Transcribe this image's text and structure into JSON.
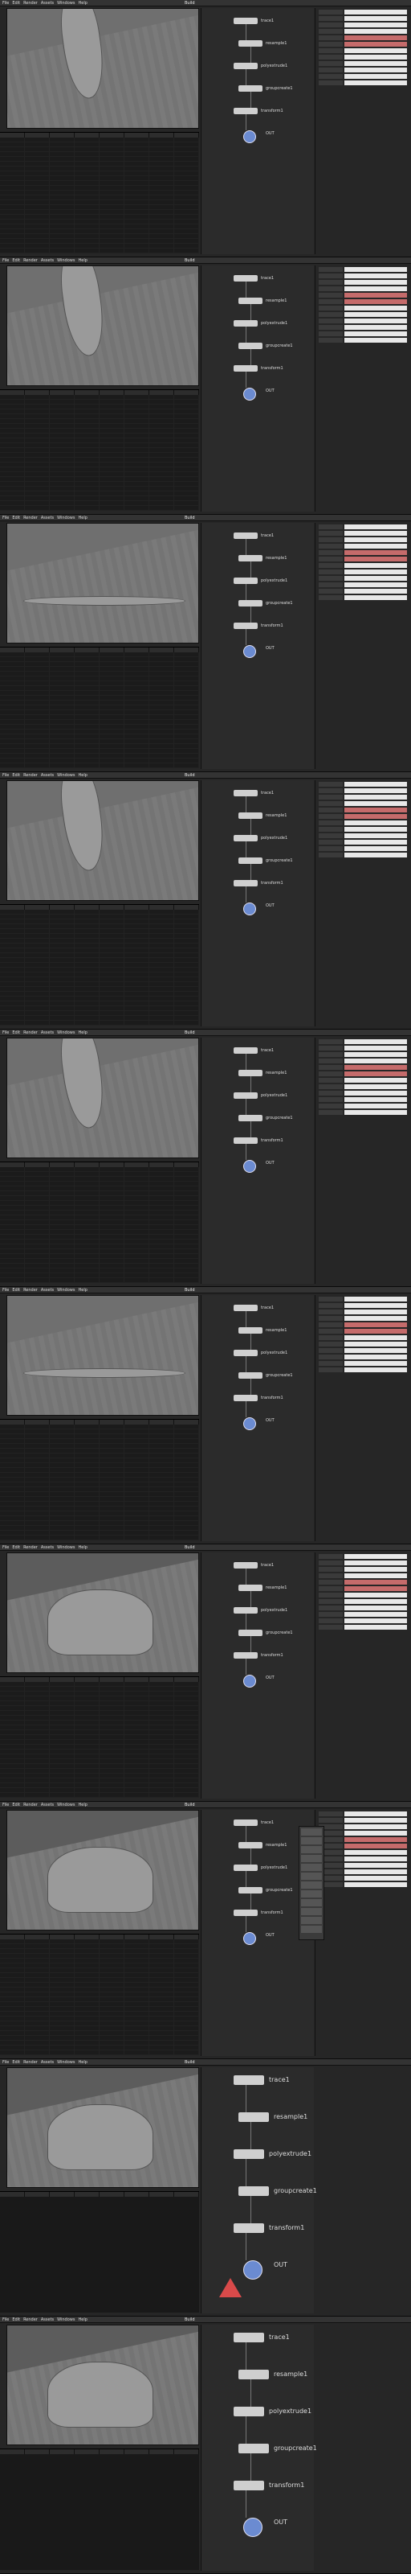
{
  "menus": [
    "File",
    "Edit",
    "Render",
    "Assets",
    "Windows",
    "Help"
  ],
  "desktop_label": "Build",
  "frames": [
    {
      "nodes": [
        "trace1",
        "resample1",
        "polyextrude1",
        "groupcreate1",
        "transform1",
        "OUT"
      ]
    },
    {
      "nodes": [
        "trace1",
        "resample1",
        "polyextrude1",
        "groupcreate1",
        "transform1",
        "OUT"
      ]
    },
    {
      "nodes": [
        "trace1",
        "resample1",
        "polyextrude1",
        "groupcreate1",
        "transform1",
        "OUT"
      ]
    },
    {
      "nodes": [
        "trace1",
        "resample1",
        "polyextrude1",
        "groupcreate1",
        "transform1",
        "OUT"
      ]
    },
    {
      "nodes": [
        "trace1",
        "resample1",
        "polyextrude1",
        "groupcreate1",
        "transform1",
        "OUT"
      ]
    },
    {
      "nodes": [
        "trace1",
        "resample1",
        "polyextrude1",
        "groupcreate1",
        "transform1",
        "OUT"
      ]
    },
    {
      "nodes": [
        "trace1",
        "resample1",
        "polyextrude1",
        "groupcreate1",
        "transform1",
        "OUT"
      ]
    },
    {
      "nodes": [
        "trace1",
        "resample1",
        "polyextrude1",
        "groupcreate1",
        "transform1",
        "OUT"
      ]
    },
    {
      "nodes": [
        "trace1",
        "resample1",
        "polyextrude1",
        "groupcreate1",
        "transform1",
        "OUT"
      ]
    },
    {
      "nodes": [
        "trace1",
        "resample1",
        "polyextrude1",
        "groupcreate1",
        "transform1",
        "OUT"
      ]
    }
  ]
}
